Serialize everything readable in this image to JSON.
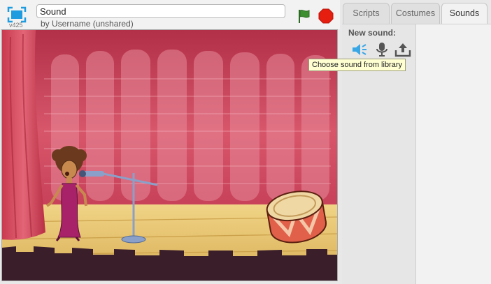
{
  "header": {
    "version": "v425",
    "project_title": "Sound",
    "byline": "by Username (unshared)"
  },
  "controls": {
    "fullscreen_icon": "fullscreen-icon",
    "flag_icon": "green-flag-icon",
    "stop_icon": "stop-icon"
  },
  "tabs": [
    {
      "label": "Scripts",
      "active": false
    },
    {
      "label": "Costumes",
      "active": false
    },
    {
      "label": "Sounds",
      "active": true
    }
  ],
  "sounds_panel": {
    "new_sound_label": "New sound:",
    "buttons": [
      {
        "icon": "speaker-icon",
        "action": "library"
      },
      {
        "icon": "microphone-icon",
        "action": "record"
      },
      {
        "icon": "upload-icon",
        "action": "upload"
      }
    ],
    "tooltip": "Choose sound from library"
  },
  "colors": {
    "accent_blue": "#1f9be0",
    "flag_green": "#3d8f2f",
    "stop_red": "#e61e10",
    "curtain": "#d94a5e",
    "floor": "#e8c873"
  }
}
